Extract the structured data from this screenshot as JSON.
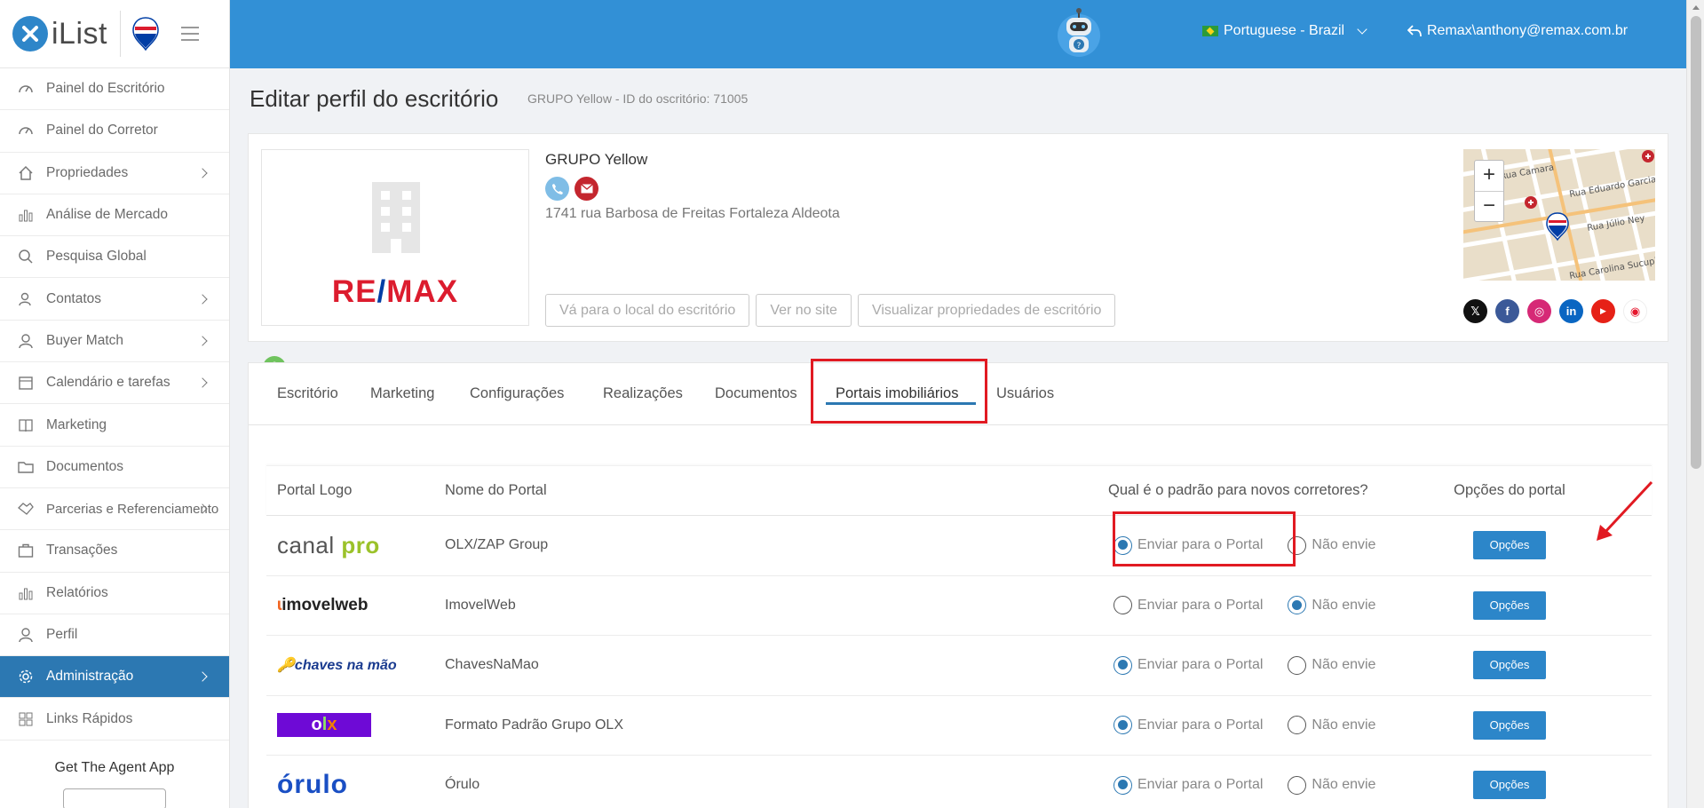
{
  "sidebar": {
    "logo_text": "iList",
    "items": [
      {
        "label": "Painel do Escritório",
        "icon": "gauge-icon",
        "chevron": false
      },
      {
        "label": "Painel do Corretor",
        "icon": "gauge-icon",
        "chevron": false
      },
      {
        "label": "Propriedades",
        "icon": "home-icon",
        "chevron": true
      },
      {
        "label": "Análise de Mercado",
        "icon": "bar-chart-icon",
        "chevron": false
      },
      {
        "label": "Pesquisa Global",
        "icon": "search-icon",
        "chevron": false
      },
      {
        "label": "Contatos",
        "icon": "contacts-icon",
        "chevron": true
      },
      {
        "label": "Buyer Match",
        "icon": "user-icon",
        "chevron": true
      },
      {
        "label": "Calendário e tarefas",
        "icon": "calendar-icon",
        "chevron": true
      },
      {
        "label": "Marketing",
        "icon": "book-icon",
        "chevron": false
      },
      {
        "label": "Documentos",
        "icon": "folder-icon",
        "chevron": false
      },
      {
        "label": "Parcerias e Referenciamento",
        "icon": "handshake-icon",
        "chevron": true
      },
      {
        "label": "Transações",
        "icon": "briefcase-icon",
        "chevron": false
      },
      {
        "label": "Relatórios",
        "icon": "bar-chart-icon",
        "chevron": false
      },
      {
        "label": "Perfil",
        "icon": "user-icon",
        "chevron": false
      },
      {
        "label": "Administração",
        "icon": "gear-icon",
        "chevron": true,
        "active": true
      },
      {
        "label": "Links Rápidos",
        "icon": "grid-icon",
        "chevron": false
      }
    ],
    "bottom_text": "Get The Agent App"
  },
  "topbar": {
    "language": "Portuguese - Brazil",
    "user": "Remax\\anthony@remax.com.br"
  },
  "page": {
    "title": "Editar perfil do escritório",
    "subtitle": "GRUPO Yellow - ID do oscritório: 71005"
  },
  "office": {
    "name": "GRUPO Yellow",
    "address": "1741 rua Barbosa de Freitas Fortaleza Aldeota",
    "logo_text_left": "RE",
    "logo_text_slash": "/",
    "logo_text_right": "MAX",
    "buttons": [
      "Vá para o local do escritório",
      "Ver no site",
      "Visualizar propriedades de escritório"
    ],
    "map_zoom_in": "+",
    "map_zoom_out": "−",
    "map_streets": [
      "Rua Camara",
      "Rua Eduardo Garcia",
      "Rua Júlio Ney",
      "Rua Carolina Sucupira"
    ]
  },
  "tabs": [
    "Escritório",
    "Marketing",
    "Configurações",
    "Realizações",
    "Documentos",
    "Portais imobiliários",
    "Usuários"
  ],
  "active_tab": "Portais imobiliários",
  "portals": {
    "headers": {
      "logo": "Portal Logo",
      "name": "Nome do Portal",
      "default": "Qual é o padrão para novos corretores?",
      "options": "Opções do portal"
    },
    "send_label": "Enviar para o Portal",
    "no_send_label": "Não envie",
    "options_button": "Opções",
    "rows": [
      {
        "name": "OLX/ZAP Group",
        "logo": "canal pro",
        "send": true
      },
      {
        "name": "ImovelWeb",
        "logo": "imovelweb",
        "send": false
      },
      {
        "name": "ChavesNaMao",
        "logo": "chaves na mão",
        "send": true
      },
      {
        "name": "Formato Padrão Grupo OLX",
        "logo": "OLX",
        "send": true
      },
      {
        "name": "Órulo",
        "logo": "órulo",
        "send": true
      }
    ]
  },
  "colors": {
    "topbar": "#3290d6",
    "active_nav": "#2c78b2",
    "highlight": "#e11a22",
    "button": "#2c86c9"
  }
}
